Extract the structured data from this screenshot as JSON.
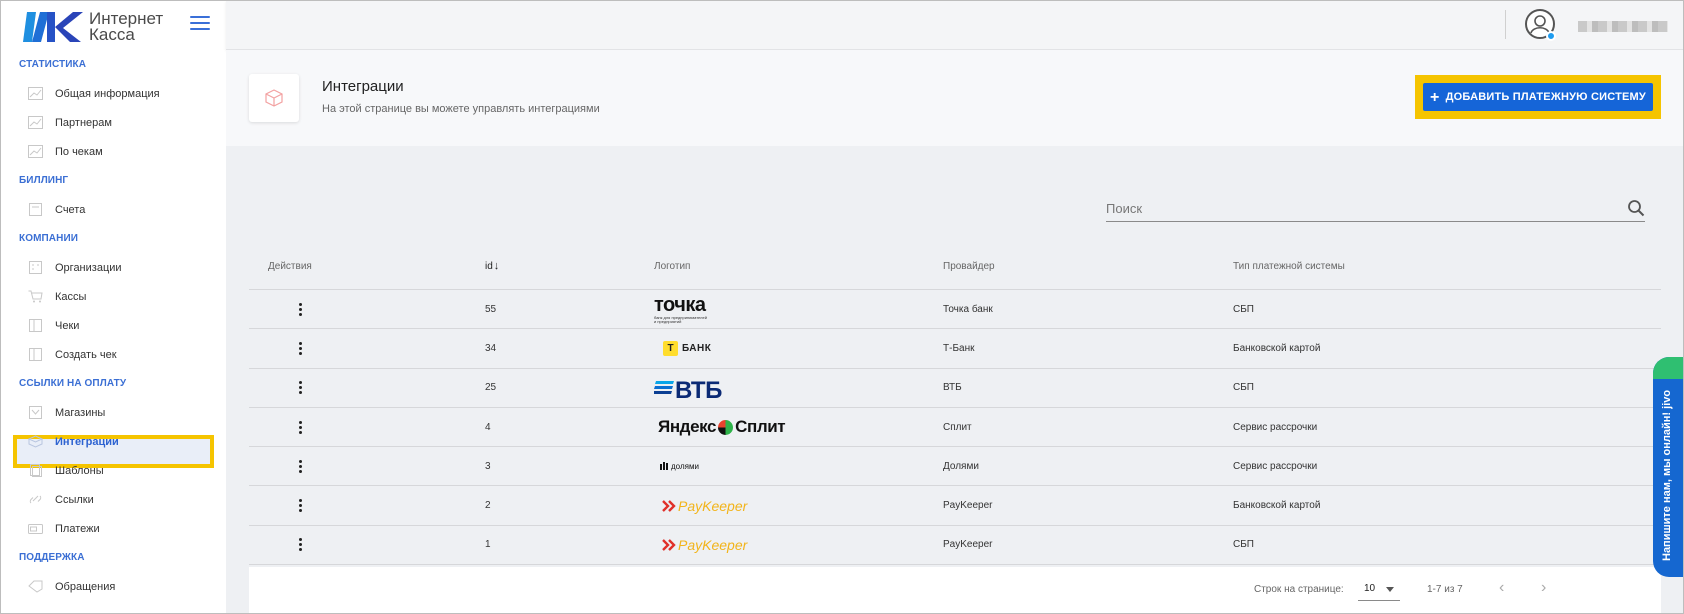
{
  "brand": {
    "line1": "Интернет",
    "line2": "Касса"
  },
  "sidebar": {
    "sections": [
      {
        "title": "СТАТИСТИКА",
        "items": [
          {
            "label": "Общая информация",
            "icon": "chart-icon"
          },
          {
            "label": "Партнерам",
            "icon": "chart-icon"
          },
          {
            "label": "По чекам",
            "icon": "chart-icon"
          }
        ]
      },
      {
        "title": "БИЛЛИНГ",
        "items": [
          {
            "label": "Счета",
            "icon": "invoice-icon"
          }
        ]
      },
      {
        "title": "КОМПАНИИ",
        "items": [
          {
            "label": "Организации",
            "icon": "building-icon"
          },
          {
            "label": "Кассы",
            "icon": "cart-icon"
          },
          {
            "label": "Чеки",
            "icon": "receipt-icon"
          },
          {
            "label": "Создать чек",
            "icon": "receipt-icon"
          }
        ]
      },
      {
        "title": "ССЫЛКИ НА ОПЛАТУ",
        "items": [
          {
            "label": "Магазины",
            "icon": "store-icon"
          },
          {
            "label": "Интеграции",
            "icon": "box-icon",
            "active": true
          },
          {
            "label": "Шаблоны",
            "icon": "template-icon"
          },
          {
            "label": "Ссылки",
            "icon": "link-icon"
          },
          {
            "label": "Платежи",
            "icon": "payment-icon"
          }
        ]
      },
      {
        "title": "ПОДДЕРЖКА",
        "items": [
          {
            "label": "Обращения",
            "icon": "tag-icon"
          }
        ]
      }
    ]
  },
  "header": {
    "title": "Интеграции",
    "subtitle": "На этой странице вы можете управлять интеграциями",
    "add_button": "ДОБАВИТЬ ПЛАТЕЖНУЮ СИСТЕМУ"
  },
  "search": {
    "placeholder": "Поиск"
  },
  "table": {
    "columns": {
      "actions": "Действия",
      "id": "id",
      "logo": "Логотип",
      "provider": "Провайдер",
      "type": "Тип платежной системы"
    },
    "rows": [
      {
        "id": "55",
        "logo": "tochka",
        "provider": "Точка банк",
        "type": "СБП"
      },
      {
        "id": "34",
        "logo": "tbank",
        "provider": "Т-Банк",
        "type": "Банковской картой"
      },
      {
        "id": "25",
        "logo": "vtb",
        "provider": "ВТБ",
        "type": "СБП"
      },
      {
        "id": "4",
        "logo": "split",
        "provider": "Сплит",
        "type": "Сервис рассрочки"
      },
      {
        "id": "3",
        "logo": "dolyami",
        "provider": "Долями",
        "type": "Сервис рассрочки"
      },
      {
        "id": "2",
        "logo": "paykeeper",
        "provider": "PayKeeper",
        "type": "Банковской картой"
      },
      {
        "id": "1",
        "logo": "paykeeper",
        "provider": "PayKeeper",
        "type": "СБП"
      }
    ]
  },
  "logos": {
    "tochka": {
      "main": "точка",
      "sub1": "банк для предпринимателей",
      "sub2": "и предприятий"
    },
    "tbank": {
      "letter": "Т",
      "text": "БАНК"
    },
    "vtb": {
      "text": "ВТБ"
    },
    "split": {
      "left": "Яндекс",
      "right": "Сплит"
    },
    "dolyami": {
      "text": "долями"
    },
    "paykeeper": {
      "text": "PayKeeper"
    }
  },
  "pagination": {
    "rows_label": "Строк на странице:",
    "rows_value": "10",
    "range": "1-7 из 7"
  },
  "jivo": {
    "text": "Напишите нам, мы онлайн! jivo"
  },
  "colors": {
    "accent": "#1565d8",
    "highlight": "#f5c400",
    "nav_section": "#3b6fd4"
  }
}
